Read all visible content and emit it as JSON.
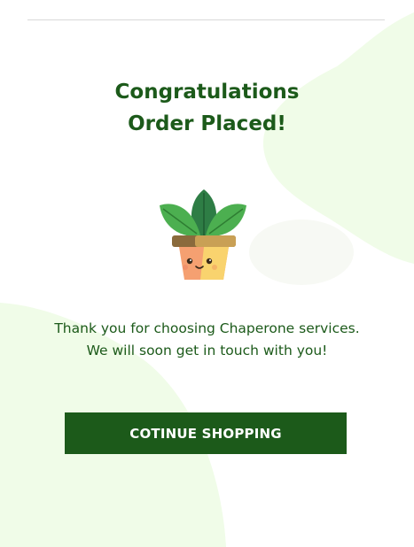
{
  "confirmation": {
    "title_line_1": "Congratulations",
    "title_line_2": "Order Placed!",
    "illustration": "potted-plant-icon",
    "message_line_1": "Thank you for choosing Chaperone services.",
    "message_line_2": "We will soon get in touch with you!",
    "cta_label": "COTINUE SHOPPING"
  },
  "colors": {
    "brand_green": "#1c5a1a",
    "background_blob": "#f0fce8",
    "background": "#ffffff"
  }
}
